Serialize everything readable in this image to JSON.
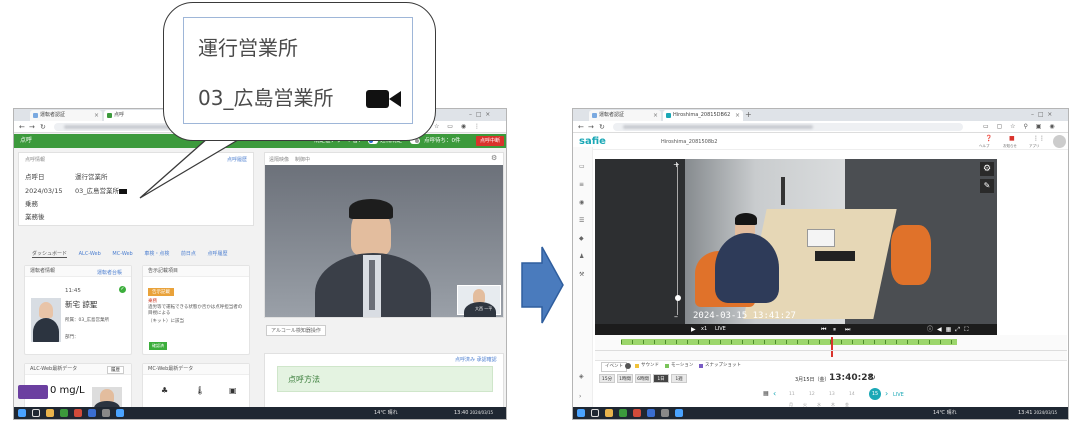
{
  "bubble": {
    "line1": "運行営業所",
    "line2": "03_広島営業所"
  },
  "left_screen": {
    "tabs": [
      "運転者認証",
      "点呼"
    ],
    "header": {
      "brand": "点呼",
      "alert_label": "規定値アラート音：",
      "alert_toggle_1": "遠隔規定",
      "alert_toggle_2": "点呼待ち：0件",
      "wait_button": "点呼中断"
    },
    "info_panel": {
      "title": "点呼情報",
      "link": "点呼履歴",
      "rows": [
        {
          "label": "点呼日",
          "value": "運行営業所"
        },
        {
          "label": "2024/03/15",
          "value": "03_広島営業所"
        },
        {
          "label": "乗務",
          "value": ""
        },
        {
          "label": "業務後",
          "value": ""
        }
      ]
    },
    "subtabs": [
      "ダッシュボード",
      "ALC-Web",
      "MC-Web",
      "車検・点検",
      "前日点",
      "点呼履歴"
    ],
    "driver_card": {
      "title": "運転者情報",
      "link": "運転者台帳",
      "time": "11:45",
      "name": "新宅 諒聖",
      "affiliation": "所属：03_広島営業所",
      "dept": "部門："
    },
    "notice_card": {
      "title": "告示記載項目",
      "badge": "告示記載",
      "lines": [
        "乗務",
        "過労等で運転できる状態か否かは点呼担当者の目視による",
        "（キット）に該当"
      ],
      "ok": "確認済"
    },
    "video_panel": {
      "title": "遠隔映像",
      "status": "制御中"
    },
    "video_button": "アルコール検知器操作",
    "alc_card": {
      "title": "ALC-Web最新データ",
      "button": "履歴"
    },
    "mc_card": {
      "title": "MC-Web最新データ"
    },
    "reading": "0 mg/L",
    "pip_label": "大西 一平",
    "method_panel": {
      "title": "点呼方法",
      "link": "点呼済み 承認確認"
    },
    "taskbar": {
      "weather": "14℃ 晴れ",
      "time": "13:40",
      "date": "2024/03/15"
    }
  },
  "right_screen": {
    "tabs": [
      "運転者認証",
      "Hiroshima_20815DB62"
    ],
    "brand": "safie",
    "camera_title": "Hiroshima_2081508b2",
    "header_icons": [
      "ヘルプ",
      "お知らせ",
      "アプリ"
    ],
    "timestamp": "2024-03-15 13:41:27",
    "player_speed": "x1",
    "player_live": "LIVE",
    "events": [
      "イベント",
      "サウンド",
      "モーション",
      "スナップショット"
    ],
    "ranges": [
      "15分",
      "1時間",
      "6時間",
      "1日",
      "1週"
    ],
    "date_label": "3月15日（金）",
    "time_display": "13:40:28",
    "days": [
      "11",
      "12",
      "13",
      "14",
      "15"
    ],
    "weekdays": [
      "月",
      "火",
      "水",
      "木",
      "金",
      "土",
      "日"
    ],
    "live_link": "LIVE",
    "taskbar": {
      "weather": "14℃ 晴れ",
      "time": "13:41",
      "date": "2024/03/15"
    }
  },
  "colors": {
    "green_header": "#3c9a3c",
    "red_button": "#d9332c",
    "arrow_blue": "#4a7bbd",
    "safie_teal": "#1ba8b6"
  },
  "icons": [
    "video-camera-icon",
    "arrow-right-icon",
    "gear-icon",
    "search-icon",
    "windows-icon"
  ]
}
